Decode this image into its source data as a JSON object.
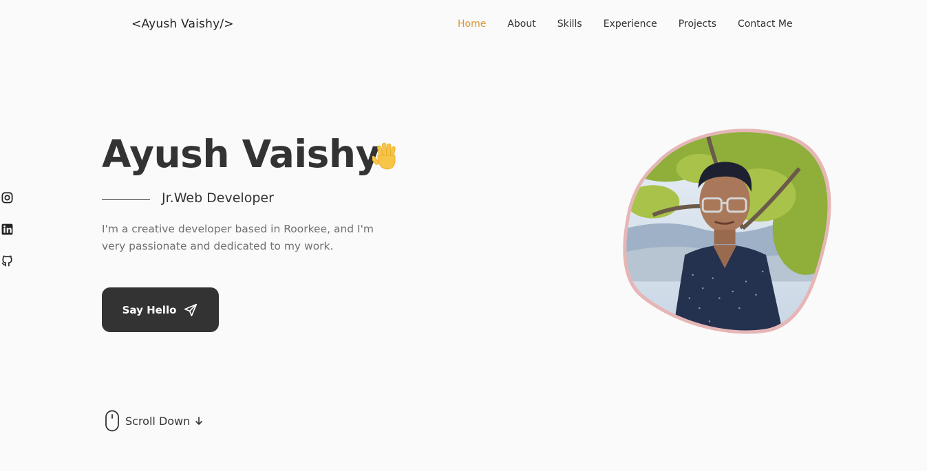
{
  "header": {
    "logo": "<Ayush Vaishy/>",
    "nav": [
      {
        "label": "Home",
        "active": true
      },
      {
        "label": "About"
      },
      {
        "label": "Skills"
      },
      {
        "label": "Experience"
      },
      {
        "label": "Projects"
      },
      {
        "label": "Contact Me"
      }
    ],
    "accent_color": "#d99431"
  },
  "socials": [
    {
      "icon": "instagram-icon"
    },
    {
      "icon": "linkedin-icon"
    },
    {
      "icon": "github-icon"
    }
  ],
  "hero": {
    "name": "Ayush Vaishy",
    "wave_icon": "waving-hand-icon",
    "role": "Jr.Web Developer",
    "description": "I'm a creative developer based in Roorkee, and I'm very passionate and dedicated to my work.",
    "cta_label": "Say Hello",
    "cta_icon": "send-icon",
    "photo_icon": "profile-photo"
  },
  "scroll": {
    "label": "Scroll Down",
    "icon": "mouse-icon",
    "arrow_icon": "arrow-down-icon"
  }
}
